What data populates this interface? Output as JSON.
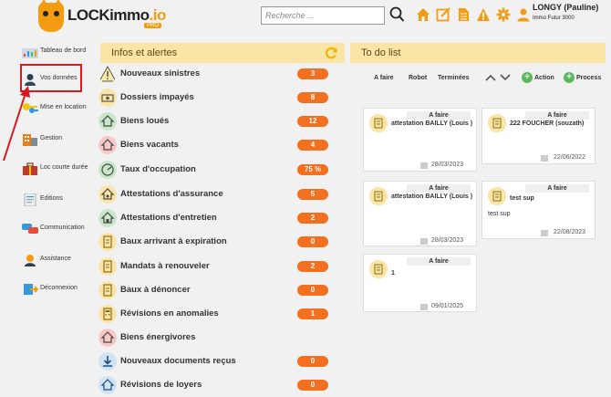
{
  "header": {
    "brand_main": "LOCKimmo",
    "brand_suffix": ".io",
    "brand_badge": "PRO",
    "search_placeholder": "Recherche ...",
    "user_name": "LONGY (Pauline)",
    "user_company": "Immo Futur 3000",
    "icons": [
      "search-icon",
      "home-icon",
      "edit-icon",
      "document-icon",
      "alert-icon",
      "gear-icon",
      "user-icon"
    ]
  },
  "sidebar": {
    "items": [
      {
        "label": "Tableau de bord",
        "icon": "dashboard-icon"
      },
      {
        "label": "Vos données",
        "icon": "person-icon"
      },
      {
        "label": "Mise en location",
        "icon": "keys-icon"
      },
      {
        "label": "Gestion",
        "icon": "building-icon"
      },
      {
        "label": "Loc courte durée",
        "icon": "suitcase-icon"
      },
      {
        "label": "Editions",
        "icon": "document-print-icon"
      },
      {
        "label": "Communication",
        "icon": "chat-icon"
      },
      {
        "label": "Assistance",
        "icon": "support-icon"
      },
      {
        "label": "Déconnexion",
        "icon": "logout-icon"
      }
    ]
  },
  "alerts": {
    "title": "Infos et alertes",
    "items": [
      {
        "label": "Nouveaux sinistres",
        "count": "3"
      },
      {
        "label": "Dossiers impayés",
        "count": "8"
      },
      {
        "label": "Biens loués",
        "count": "12"
      },
      {
        "label": "Biens vacants",
        "count": "4"
      },
      {
        "label": "Taux d'occupation",
        "count": "75 %"
      },
      {
        "label": "Attestations d'assurance",
        "count": "5"
      },
      {
        "label": "Attestations d'entretien",
        "count": "2"
      },
      {
        "label": "Baux arrivant à expiration",
        "count": "0"
      },
      {
        "label": "Mandats à renouveler",
        "count": "2"
      },
      {
        "label": "Baux à dénoncer",
        "count": "0"
      },
      {
        "label": "Révisions en anomalies",
        "count": "1"
      },
      {
        "label": "Biens énergivores",
        "count": ""
      },
      {
        "label": "Nouveaux documents reçus",
        "count": "0"
      },
      {
        "label": "Révisions de loyers",
        "count": "0"
      }
    ]
  },
  "todo": {
    "title": "To do list",
    "tabs": [
      "A faire",
      "Robot",
      "Terminées"
    ],
    "actions": [
      "Action",
      "Process"
    ],
    "cards": [
      {
        "status": "A faire",
        "title": "attestation BAILLY (Louis )",
        "sub": "",
        "date": "28/03/2023"
      },
      {
        "status": "A faire",
        "title": "222 FOUCHER (souzath)",
        "sub": "",
        "date": "22/06/2022"
      },
      {
        "status": "A faire",
        "title": "attestation BAILLY (Louis )",
        "sub": "",
        "date": "28/03/2023"
      },
      {
        "status": "A faire",
        "title": "test sup",
        "sub": "test sup",
        "date": "22/08/2023"
      },
      {
        "status": "A faire",
        "title": "1",
        "sub": "",
        "date": "09/01/2025"
      }
    ]
  },
  "colors": {
    "accent": "#f37021",
    "panel_header": "#fbe5a6",
    "annotation": "#d71920",
    "plus": "#5cb85c"
  }
}
